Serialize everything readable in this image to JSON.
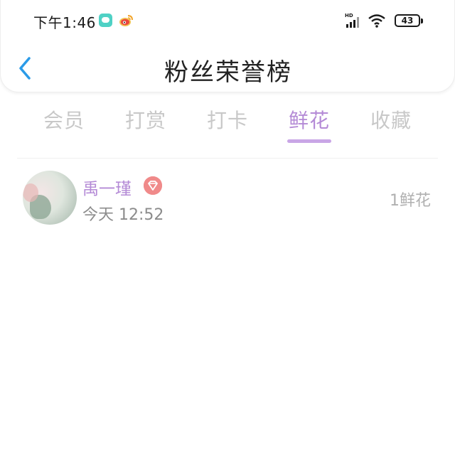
{
  "status_bar": {
    "time": "下午1:46",
    "battery": "43",
    "icons": [
      "wechat-icon",
      "weibo-icon",
      "signal-icon",
      "wifi-icon",
      "battery-icon"
    ]
  },
  "header": {
    "title": "粉丝荣誉榜",
    "back_icon": "chevron-left-icon"
  },
  "tabs": [
    {
      "label": "会员",
      "active": false
    },
    {
      "label": "打赏",
      "active": false
    },
    {
      "label": "打卡",
      "active": false
    },
    {
      "label": "鲜花",
      "active": true
    },
    {
      "label": "收藏",
      "active": false
    }
  ],
  "list": [
    {
      "name": "禹一瑾",
      "badge": "diamond-icon",
      "time": "今天 12:52",
      "count": "1鲜花"
    }
  ],
  "colors": {
    "accent": "#b48ad6",
    "indicator": "#c9a6e6",
    "back_icon": "#2b9be8",
    "badge": "#f08a8a",
    "inactive_tab": "#c8c8c8"
  }
}
